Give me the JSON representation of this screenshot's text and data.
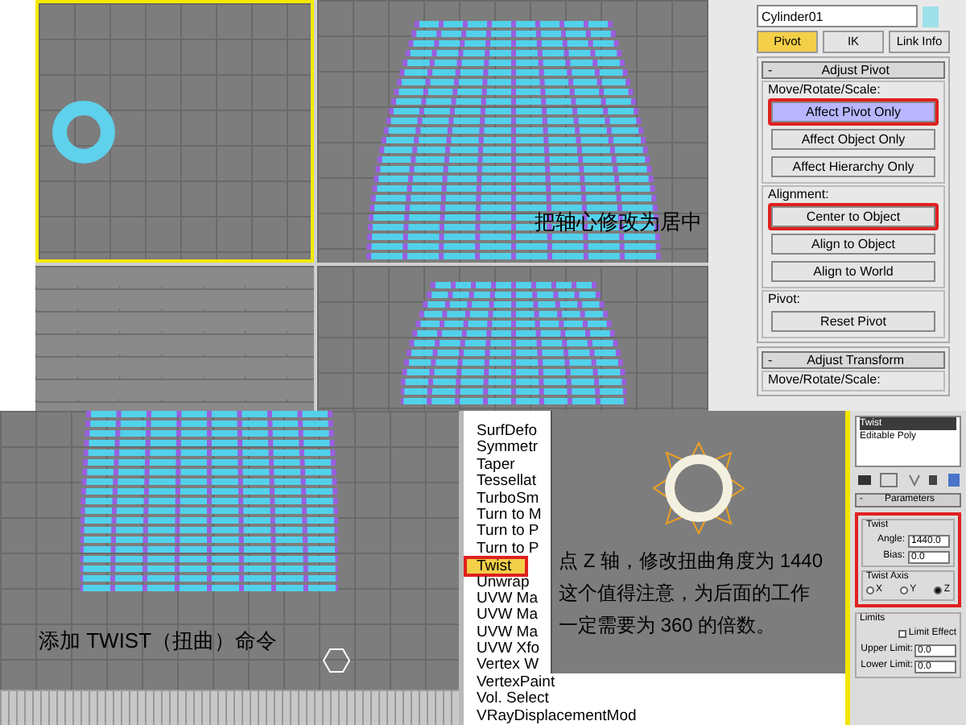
{
  "top": {
    "annotation": "把轴心修改为居中",
    "object_name": "Cylinder01",
    "tabs": [
      {
        "label": "Pivot",
        "selected": true
      },
      {
        "label": "IK",
        "selected": false
      },
      {
        "label": "Link Info",
        "selected": false
      }
    ],
    "rollouts": [
      {
        "toggle": "-",
        "title": "Adjust Pivot",
        "groups": [
          {
            "title": "Move/Rotate/Scale:",
            "buttons": [
              {
                "label": "Affect Pivot Only",
                "selected": true,
                "highlighted": true
              },
              {
                "label": "Affect Object Only",
                "selected": false,
                "highlighted": false
              },
              {
                "label": "Affect Hierarchy Only",
                "selected": false,
                "highlighted": false
              }
            ]
          },
          {
            "title": "Alignment:",
            "buttons": [
              {
                "label": "Center to Object",
                "selected": false,
                "highlighted": true
              },
              {
                "label": "Align to Object",
                "selected": false,
                "highlighted": false
              },
              {
                "label": "Align to World",
                "selected": false,
                "highlighted": false
              }
            ]
          },
          {
            "title": "Pivot:",
            "buttons": [
              {
                "label": "Reset Pivot",
                "selected": false,
                "highlighted": false
              }
            ]
          }
        ]
      },
      {
        "toggle": "-",
        "title": "Adjust Transform",
        "groups": [
          {
            "title": "Move/Rotate/Scale:"
          }
        ]
      }
    ]
  },
  "bottom": {
    "annotation": "添加 TWIST（扭曲）命令",
    "modifiers": [
      {
        "label": "SurfDefo",
        "selected": false
      },
      {
        "label": "Symmetr",
        "selected": false
      },
      {
        "label": "Taper",
        "selected": false
      },
      {
        "label": "Tessellat",
        "selected": false
      },
      {
        "label": "TurboSm",
        "selected": false
      },
      {
        "label": "Turn to M",
        "selected": false
      },
      {
        "label": "Turn to P",
        "selected": false
      },
      {
        "label": "Turn to P",
        "selected": false
      },
      {
        "label": "Twist",
        "selected": true
      },
      {
        "label": "Unwrap",
        "selected": false
      },
      {
        "label": "UVW Ma",
        "selected": false
      },
      {
        "label": "UVW Ma",
        "selected": false
      },
      {
        "label": "UVW Ma",
        "selected": false
      },
      {
        "label": "UVW Xfo",
        "selected": false
      },
      {
        "label": "Vertex W",
        "selected": false
      },
      {
        "label": "VertexPaint",
        "selected": false
      },
      {
        "label": "Vol. Select",
        "selected": false
      },
      {
        "label": "VRayDisplacementMod",
        "selected": false
      }
    ],
    "note_lines": [
      "点 Z 轴，修改扭曲角度为 1440",
      "这个值得注意，为后面的工作",
      "一定需要为 360 的倍数。"
    ],
    "twist_panel": {
      "stack": [
        {
          "label": "Twist",
          "selected": true
        },
        {
          "label": "Editable Poly",
          "selected": false
        }
      ],
      "rollout_toggle": "-",
      "rollout_title": "Parameters",
      "highlighted": true,
      "twist_group": "Twist",
      "angle_label": "Angle:",
      "angle": "1440.0",
      "bias_label": "Bias:",
      "bias": "0.0",
      "axis_group": "Twist Axis",
      "axes": [
        {
          "label": "X",
          "selected": false
        },
        {
          "label": "Y",
          "selected": false
        },
        {
          "label": "Z",
          "selected": true
        }
      ],
      "limits_group": "Limits",
      "limit_effect": {
        "label": "Limit Effect",
        "checked": false
      },
      "upper_label": "Upper Limit:",
      "upper": "0.0",
      "lower_label": "Lower Limit:",
      "lower": "0.0"
    }
  }
}
